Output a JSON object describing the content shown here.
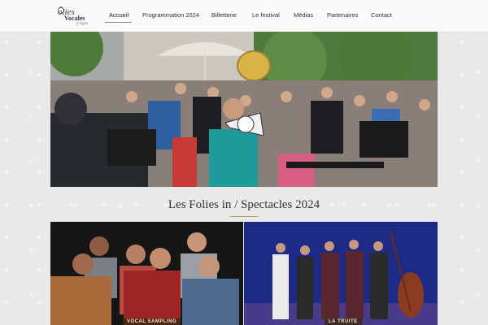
{
  "site": {
    "logo": {
      "line1": "olies",
      "line2": "Vocales",
      "line3": "d'Agen"
    }
  },
  "nav": {
    "items": [
      {
        "label": "Accueil",
        "active": true
      },
      {
        "label": "Programmation 2024"
      },
      {
        "label": "Billetterie"
      },
      {
        "label": "Le festival"
      },
      {
        "label": "Médias"
      },
      {
        "label": "Partenaires"
      },
      {
        "label": "Contact"
      }
    ]
  },
  "main": {
    "section_title": "Les Folies in / Spectacles 2024",
    "cards": [
      {
        "caption": "VOCAL SAMPLING"
      },
      {
        "caption": "LA TRUITE"
      }
    ]
  },
  "colors": {
    "accent": "#b99a5a",
    "nav_bg": "#fafafa",
    "stage_blue": "#1c2a7a"
  }
}
